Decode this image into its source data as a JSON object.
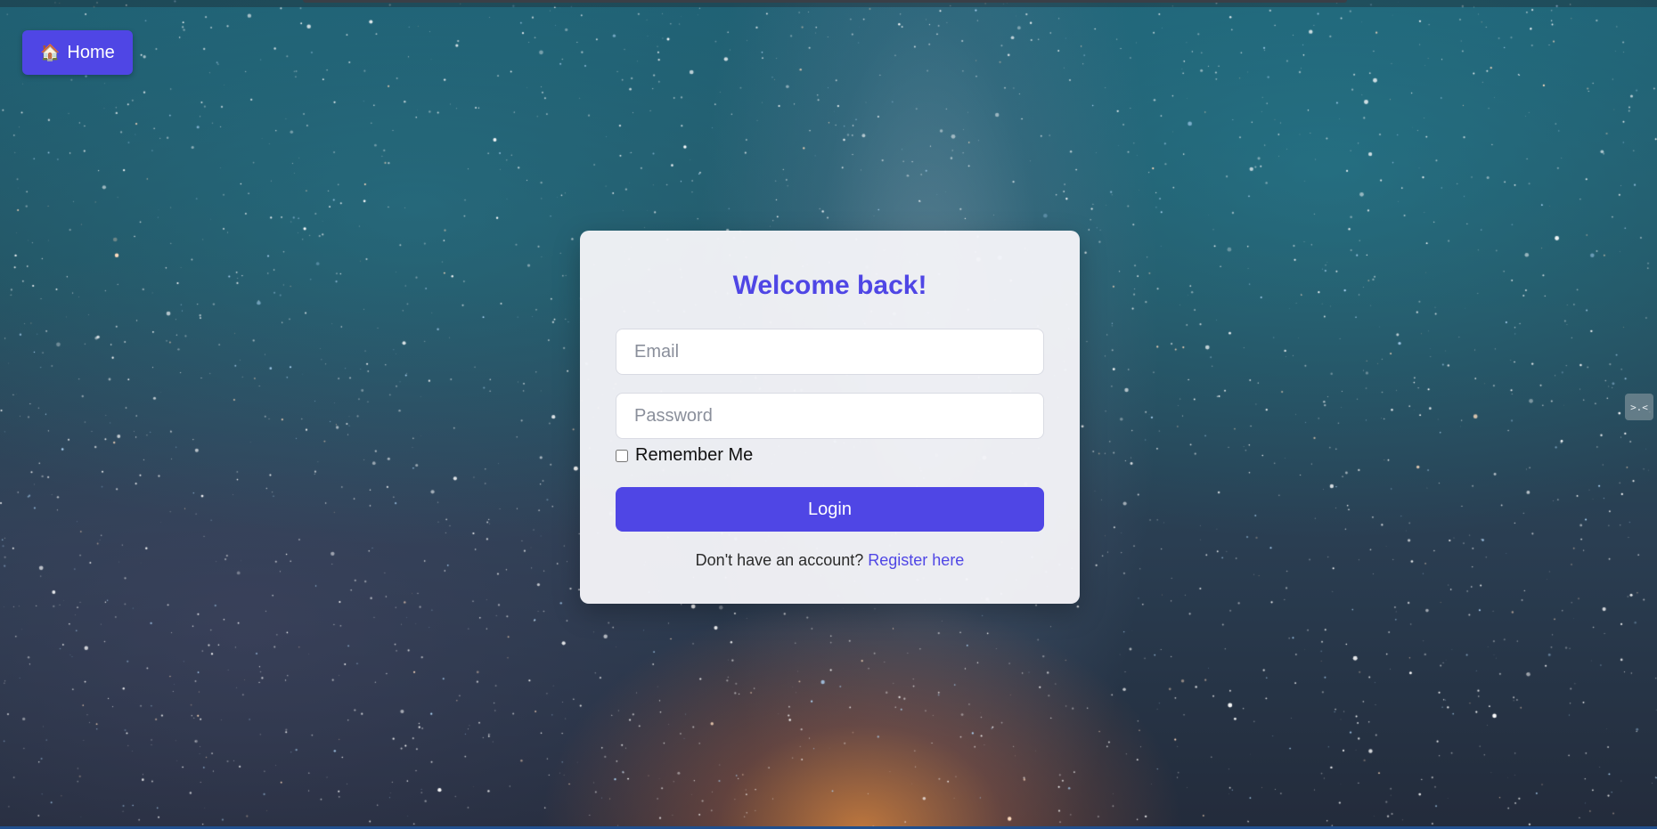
{
  "nav": {
    "home_label": "Home",
    "home_icon": "house-icon"
  },
  "login_card": {
    "title": "Welcome back!",
    "email_placeholder": "Email",
    "password_placeholder": "Password",
    "remember_label": "Remember Me",
    "remember_checked": false,
    "submit_label": "Login",
    "register_prompt": "Don't have an account?",
    "register_link": "Register here"
  },
  "side_widget": {
    "icon": "collapse-arrows-icon",
    "glyph": ">.<"
  },
  "colors": {
    "accent": "#4f46e5",
    "card_bg": "#f4f4f8"
  }
}
